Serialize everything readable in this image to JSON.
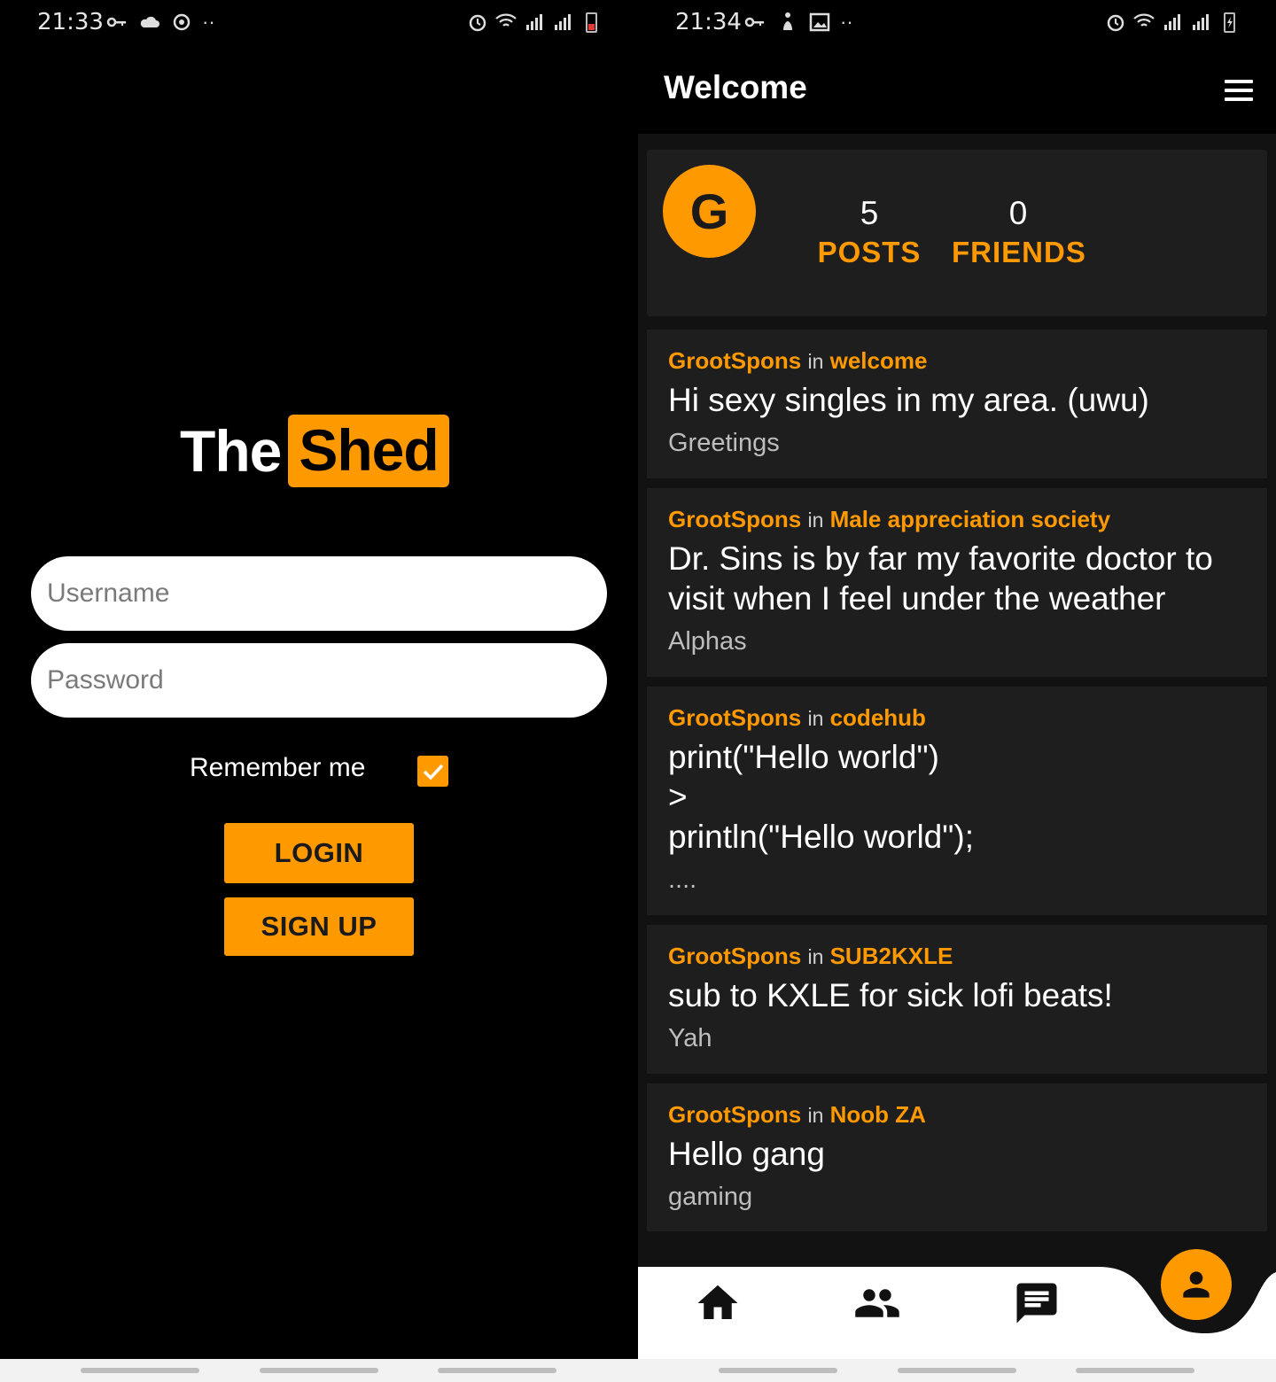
{
  "login_screen": {
    "status_bar": {
      "time": "21:33"
    },
    "logo": {
      "part1": "The",
      "part2": "Shed"
    },
    "username": {
      "placeholder": "Username",
      "value": ""
    },
    "password": {
      "placeholder": "Password",
      "value": ""
    },
    "remember_label": "Remember me",
    "remember_checked": true,
    "login_label": "LOGIN",
    "signup_label": "SIGN UP"
  },
  "feed_screen": {
    "status_bar": {
      "time": "21:34"
    },
    "title": "Welcome",
    "profile": {
      "initial": "G",
      "posts_count": "5",
      "posts_label": "POSTS",
      "friends_count": "0",
      "friends_label": "FRIENDS"
    },
    "posts": [
      {
        "author": "GrootSpons",
        "in": "in",
        "community": "welcome",
        "body": "Hi sexy singles in my area. (uwu)",
        "tag": "Greetings"
      },
      {
        "author": "GrootSpons",
        "in": "in",
        "community": "Male appreciation society",
        "body": "Dr. Sins is by far my favorite doctor to visit when I feel under the weather",
        "tag": "Alphas"
      },
      {
        "author": "GrootSpons",
        "in": "in",
        "community": "codehub",
        "body": "print(\"Hello world\")\n >\nprintln(\"Hello world\");",
        "tag": "...."
      },
      {
        "author": "GrootSpons",
        "in": "in",
        "community": "SUB2KXLE",
        "body": "sub to KXLE for sick lofi beats!",
        "tag": "Yah"
      },
      {
        "author": "GrootSpons",
        "in": "in",
        "community": "Noob ZA",
        "body": "Hello gang",
        "tag": "gaming"
      }
    ],
    "bottom_nav": [
      "home-icon",
      "people-icon",
      "chat-icon",
      "person-icon"
    ]
  },
  "colors": {
    "accent": "#ff9900",
    "background": "#000000",
    "card": "#1e1e1e"
  }
}
